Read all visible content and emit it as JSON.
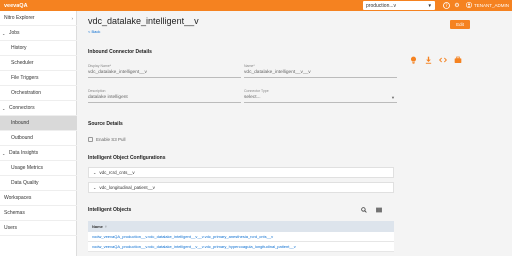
{
  "topbar": {
    "brand": "veevaQA",
    "environment": "production...v",
    "help_icon": "help-icon",
    "settings_icon": "gear-icon",
    "user_label": "TENANT_ADMIN",
    "accent_color": "#f58220"
  },
  "sidebar": {
    "items": [
      {
        "label": "Nitro Explorer",
        "type": "top",
        "chevron": "chevron-right-icon"
      },
      {
        "label": "Jobs",
        "type": "group",
        "expanded": true
      },
      {
        "label": "History",
        "type": "child"
      },
      {
        "label": "Scheduler",
        "type": "child"
      },
      {
        "label": "File Triggers",
        "type": "child"
      },
      {
        "label": "Orchestration",
        "type": "child"
      },
      {
        "label": "Connectors",
        "type": "group",
        "expanded": true
      },
      {
        "label": "Inbound",
        "type": "child",
        "active": true
      },
      {
        "label": "Outbound",
        "type": "child"
      },
      {
        "label": "Data Insights",
        "type": "group",
        "expanded": true
      },
      {
        "label": "Usage Metrics",
        "type": "child"
      },
      {
        "label": "Data Quality",
        "type": "child"
      },
      {
        "label": "Workspaces",
        "type": "top"
      },
      {
        "label": "Schemas",
        "type": "top"
      },
      {
        "label": "Users",
        "type": "top"
      }
    ]
  },
  "header": {
    "title": "vdc_datalake_intelligent__v",
    "back_label": "< Back",
    "edit_label": "Edit"
  },
  "inbound_details": {
    "heading": "Inbound Connector Details",
    "icons": [
      "bulb-icon",
      "download-icon",
      "code-icon",
      "briefcase-icon"
    ],
    "fields": {
      "display_name": {
        "label": "Display Name*",
        "value": "vdc_datalake_intelligent__v"
      },
      "name": {
        "label": "Name*",
        "value": "vdc_datalake_intelligent__v__v"
      },
      "description": {
        "label": "Description",
        "value": "datalake intelligent"
      },
      "connector_type": {
        "label": "Connector Type",
        "value": "select..."
      }
    }
  },
  "source_details": {
    "heading": "Source Details",
    "checkbox_label": "Enable S3 Pull",
    "checked": false
  },
  "configurations": {
    "heading": "Intelligent Object Configurations",
    "items": [
      "vdc_rcrd_cnts__v",
      "vdc_longitudinal_patient__v"
    ]
  },
  "objects": {
    "heading": "Intelligent Objects",
    "tool_icons": [
      "search-icon",
      "columns-icon"
    ],
    "column_name": "Name",
    "sort_icon": "arrow-up-icon",
    "rows": [
      "vodw_veevaQA_production__v.vdc_datalake_intelligent__v__v.vdc_primary_anesthesia_rcrd_cnts__v",
      "vodw_veevaQA_production__v.vdc_datalake_intelligent__v__v.vdc_primary_hypercoagula_longitudinal_patient__v"
    ]
  }
}
